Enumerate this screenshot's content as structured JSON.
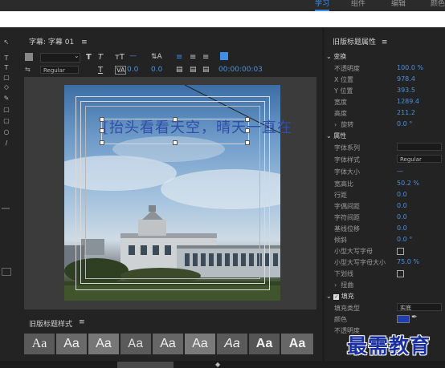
{
  "workspace": {
    "tabs": [
      "学习",
      "组件",
      "编辑",
      "颜色"
    ],
    "active": "学习"
  },
  "tools_left": [
    "T",
    "T",
    "▢",
    "◇",
    "✎",
    "↖",
    "▢",
    "▢",
    "○",
    "/"
  ],
  "titler": {
    "panel_title": "字幕: 字幕 01",
    "menu_icon": "≡",
    "toolbar": {
      "font_style": "Regular",
      "tracking_value": "0.0",
      "kerning_value": "0.0",
      "baseline_value": "0.0",
      "timecode": "00:00:00:03"
    },
    "caption_text": "[抬头看看天空，晴天一直在",
    "styles_panel_title": "旧版标题样式",
    "style_swatches": [
      "Aa",
      "Aa",
      "Aa",
      "Aa",
      "Aa",
      "Aa",
      "Aa",
      "Aa",
      "Aa"
    ]
  },
  "properties": {
    "panel_title": "旧版标题属性",
    "menu_icon": "≡",
    "transform": {
      "section": "变换",
      "opacity_label": "不透明度",
      "opacity": "100.0 %",
      "x_label": "X 位置",
      "x": "978.4",
      "y_label": "Y 位置",
      "y": "393.5",
      "width_label": "宽度",
      "width": "1289.4",
      "height_label": "高度",
      "height": "211.2",
      "rotation_label": "旋转",
      "rotation": "0.0 °"
    },
    "props": {
      "section": "属性",
      "font_family_label": "字体系列",
      "font_style_label": "字体样式",
      "font_style": "Regular",
      "font_size_label": "字体大小",
      "font_size": "—",
      "aspect_label": "宽高比",
      "aspect": "50.2 %",
      "leading_label": "行距",
      "leading": "0.0",
      "kerning_label": "字偶间距",
      "kerning": "0.0",
      "tracking_label": "字符间距",
      "tracking": "0.0",
      "baseline_label": "基线位移",
      "baseline": "0.0",
      "slant_label": "倾斜",
      "slant": "0.0 °",
      "smallcaps_label": "小型大写字母",
      "smallcaps_size_label": "小型大写字母大小",
      "smallcaps_size": "75.0 %",
      "underline_label": "下划线",
      "distort_label": "扭曲"
    },
    "fill": {
      "section": "填充",
      "fill_type_label": "填充类型",
      "fill_type": "实底",
      "color_label": "颜色",
      "opacity_label": "不透明度",
      "color_swatch": "#1f3fb0"
    }
  },
  "watermark": "最需教育",
  "colors": {
    "accent": "#3f8fe8",
    "value_blue": "#4a90e2",
    "caption": "#2f4fa8",
    "watermark": "#1a2fa0"
  }
}
